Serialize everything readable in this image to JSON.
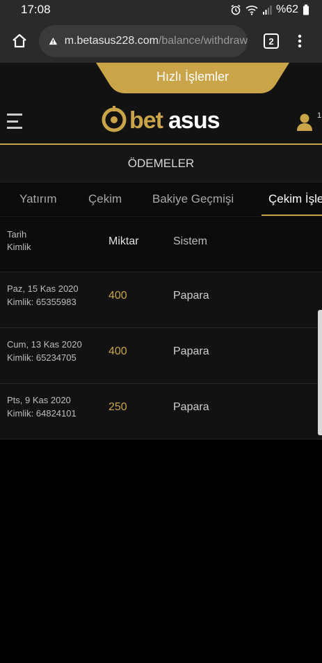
{
  "status_bar": {
    "time": "17:08",
    "battery": "%62"
  },
  "browser": {
    "url_host": "m.betasus228.com",
    "url_path": "/balance/withdraw",
    "tab_count": "2"
  },
  "header": {
    "quick_actions": "Hızlı İşlemler",
    "logo_text": "betasus",
    "user_badge": "1"
  },
  "page": {
    "title": "ÖDEMELER"
  },
  "tabs": [
    {
      "label": "Yatırım"
    },
    {
      "label": "Çekim"
    },
    {
      "label": "Bakiye Geçmişi"
    },
    {
      "label": "Çekim İşlemleri",
      "active": true
    }
  ],
  "table": {
    "headers": {
      "date": "Tarih",
      "id": "Kimlik",
      "amount": "Miktar",
      "system": "Sistem"
    },
    "rows": [
      {
        "date": "Paz, 15 Kas 2020",
        "id": "Kimlik: 65355983",
        "amount": "400",
        "system": "Papara"
      },
      {
        "date": "Cum, 13 Kas 2020",
        "id": "Kimlik: 65234705",
        "amount": "400",
        "system": "Papara"
      },
      {
        "date": "Pts, 9 Kas 2020",
        "id": "Kimlik: 64824101",
        "amount": "250",
        "system": "Papara"
      }
    ]
  },
  "colors": {
    "accent_gold": "#c9a448",
    "background": "#000000",
    "panel": "#121212"
  }
}
